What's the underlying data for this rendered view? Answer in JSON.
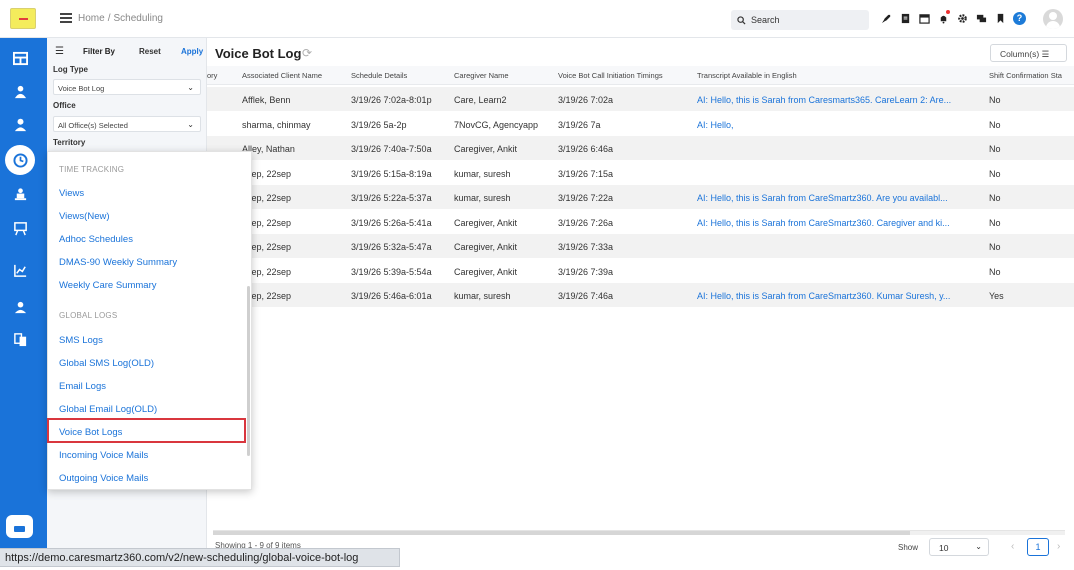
{
  "header": {
    "breadcrumb": [
      "Home",
      "Scheduling"
    ],
    "search_placeholder": "Search",
    "icons": [
      "rocket-icon",
      "document-icon",
      "calendar-icon",
      "notification-bell-icon",
      "gear-icon",
      "chat-icon",
      "bookmark-icon",
      "help-icon"
    ],
    "help_label": "?"
  },
  "rail": {
    "icons": [
      "dashboard-icon",
      "caregiver-icon",
      "client-icon",
      "scheduling-icon",
      "training-icon",
      "reports-board-icon",
      "analytics-icon",
      "users-icon",
      "documents-icon",
      "chat-icon"
    ]
  },
  "filter": {
    "title": "Filter By",
    "reset": "Reset",
    "apply": "Apply",
    "log_type_label": "Log Type",
    "log_type_value": "Voice Bot Log",
    "office_label": "Office",
    "office_value": "All Office(s) Selected",
    "territory_label": "Territory"
  },
  "page": {
    "title": "Voice Bot Log",
    "columns_button": "Column(s)"
  },
  "table": {
    "headers": [
      "ory",
      "Associated Client Name",
      "Schedule Details",
      "Caregiver Name",
      "Voice Bot Call Initiation Timings",
      "Transcript Available in English",
      "Shift Confirmation Sta"
    ],
    "rows": [
      {
        "client": "Afflek, Benn",
        "schedule": "3/19/26 7:02a-8:01p",
        "caregiver": "Care, Learn2",
        "initiated": "3/19/26 7:02a",
        "transcript": "AI: Hello, this is Sarah from Caresmarts365. CareLearn 2: Are...",
        "confirmation": "No"
      },
      {
        "client": "sharma, chinmay",
        "schedule": "3/19/26 5a-2p",
        "caregiver": "7NovCG, Agencyapp",
        "initiated": "3/19/26 7a",
        "transcript": "AI: Hello,",
        "confirmation": "No"
      },
      {
        "client": "Alley, Nathan",
        "schedule": "3/19/26 7:40a-7:50a",
        "caregiver": "Caregiver, Ankit",
        "initiated": "3/19/26 6:46a",
        "transcript": "",
        "confirmation": "No"
      },
      {
        "client": "2sep, 22sep",
        "schedule": "3/19/26 5:15a-8:19a",
        "caregiver": "kumar, suresh",
        "initiated": "3/19/26 7:15a",
        "transcript": "",
        "confirmation": "No"
      },
      {
        "client": "2sep, 22sep",
        "schedule": "3/19/26 5:22a-5:37a",
        "caregiver": "kumar, suresh",
        "initiated": "3/19/26 7:22a",
        "transcript": "AI: Hello, this is Sarah from CareSmartz360. Are you availabl...",
        "confirmation": "No"
      },
      {
        "client": "2sep, 22sep",
        "schedule": "3/19/26 5:26a-5:41a",
        "caregiver": "Caregiver, Ankit",
        "initiated": "3/19/26 7:26a",
        "transcript": "AI: Hello, this is Sarah from CareSmartz360. Caregiver and ki...",
        "confirmation": "No"
      },
      {
        "client": "2sep, 22sep",
        "schedule": "3/19/26 5:32a-5:47a",
        "caregiver": "Caregiver, Ankit",
        "initiated": "3/19/26 7:33a",
        "transcript": "",
        "confirmation": "No"
      },
      {
        "client": "2sep, 22sep",
        "schedule": "3/19/26 5:39a-5:54a",
        "caregiver": "Caregiver, Ankit",
        "initiated": "3/19/26 7:39a",
        "transcript": "",
        "confirmation": "No"
      },
      {
        "client": "2sep, 22sep",
        "schedule": "3/19/26 5:46a-6:01a",
        "caregiver": "kumar, suresh",
        "initiated": "3/19/26 7:46a",
        "transcript": "AI: Hello, this is Sarah from CareSmartz360. Kumar Suresh, y...",
        "confirmation": "Yes"
      }
    ]
  },
  "pager": {
    "summary": "Showing 1 - 9 of 9 items",
    "show_label": "Show",
    "page_size": "10",
    "current_page": "1",
    "prev": "‹",
    "next": "›"
  },
  "menu": {
    "sections": [
      {
        "title": "TIME TRACKING",
        "items": [
          "Views",
          "Views(New)",
          "Adhoc Schedules",
          "DMAS-90 Weekly Summary",
          "Weekly Care Summary"
        ]
      },
      {
        "title": "GLOBAL LOGS",
        "items": [
          "SMS Logs",
          "Global SMS Log(OLD)",
          "Email Logs",
          "Global Email Log(OLD)",
          "Voice Bot Logs",
          "Incoming Voice Mails",
          "Outgoing Voice Mails"
        ]
      }
    ],
    "highlighted": "Voice Bot Logs"
  },
  "status_url": "https://demo.caresmartz360.com/v2/new-scheduling/global-voice-bot-log",
  "colors": {
    "accent": "#1a73d9",
    "highlight_border": "#d9363e",
    "logo": "#f4ec5c"
  }
}
